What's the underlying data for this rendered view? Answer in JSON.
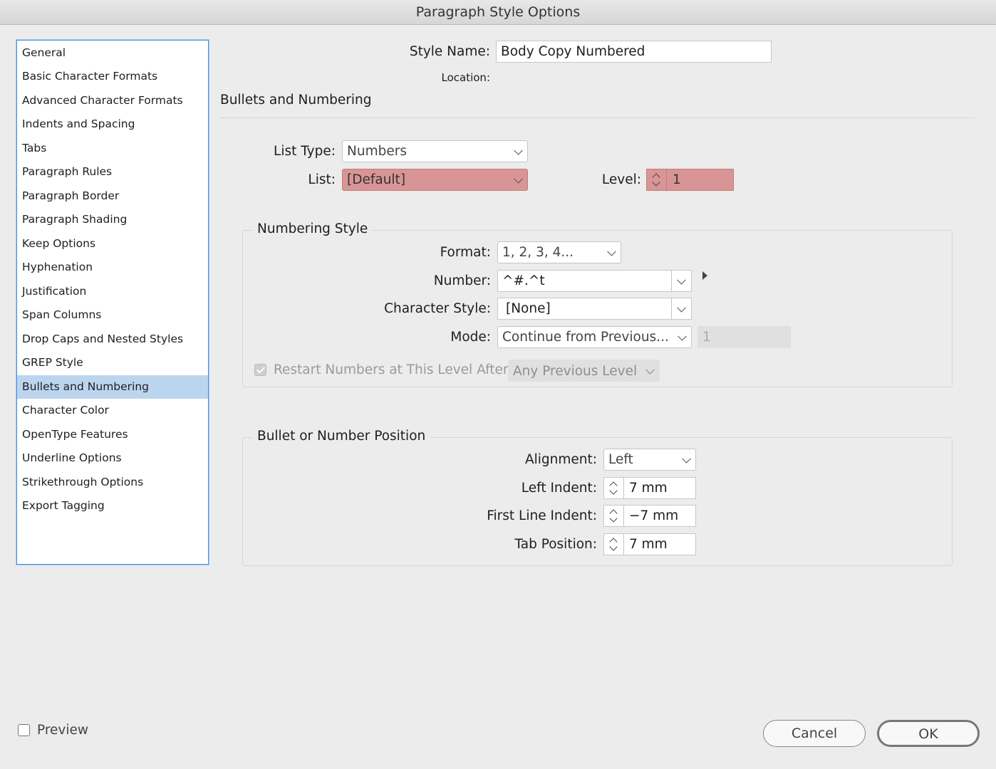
{
  "window": {
    "title": "Paragraph Style Options"
  },
  "sidebar": {
    "items": [
      {
        "label": "General"
      },
      {
        "label": "Basic Character Formats"
      },
      {
        "label": "Advanced Character Formats"
      },
      {
        "label": "Indents and Spacing"
      },
      {
        "label": "Tabs"
      },
      {
        "label": "Paragraph Rules"
      },
      {
        "label": "Paragraph Border"
      },
      {
        "label": "Paragraph Shading"
      },
      {
        "label": "Keep Options"
      },
      {
        "label": "Hyphenation"
      },
      {
        "label": "Justification"
      },
      {
        "label": "Span Columns"
      },
      {
        "label": "Drop Caps and Nested Styles"
      },
      {
        "label": "GREP Style"
      },
      {
        "label": "Bullets and Numbering",
        "selected": true
      },
      {
        "label": "Character Color"
      },
      {
        "label": "OpenType Features"
      },
      {
        "label": "Underline Options"
      },
      {
        "label": "Strikethrough Options"
      },
      {
        "label": "Export Tagging"
      }
    ]
  },
  "header": {
    "style_name_label": "Style Name:",
    "style_name_value": "Body Copy Numbered",
    "location_label": "Location:",
    "section_title": "Bullets and Numbering"
  },
  "list": {
    "list_type_label": "List Type:",
    "list_type_value": "Numbers",
    "list_label": "List:",
    "list_value": "[Default]",
    "level_label": "Level:",
    "level_value": "1",
    "highlight_color": "#d99595"
  },
  "numbering_style": {
    "title": "Numbering Style",
    "format_label": "Format:",
    "format_value": "1, 2, 3, 4...",
    "number_label": "Number:",
    "number_value": "^#.^t",
    "char_style_label": "Character Style:",
    "char_style_value": "[None]",
    "mode_label": "Mode:",
    "mode_value": "Continue from Previous...",
    "mode_start_value": "1",
    "restart_label": "Restart Numbers at This Level After:",
    "restart_checked": true,
    "restart_value": "Any Previous Level"
  },
  "position": {
    "title": "Bullet or Number Position",
    "alignment_label": "Alignment:",
    "alignment_value": "Left",
    "left_indent_label": "Left Indent:",
    "left_indent_value": "7 mm",
    "first_line_label": "First Line Indent:",
    "first_line_value": "−7 mm",
    "tab_position_label": "Tab Position:",
    "tab_position_value": "7 mm"
  },
  "footer": {
    "preview_label": "Preview",
    "preview_checked": false,
    "cancel_label": "Cancel",
    "ok_label": "OK"
  }
}
